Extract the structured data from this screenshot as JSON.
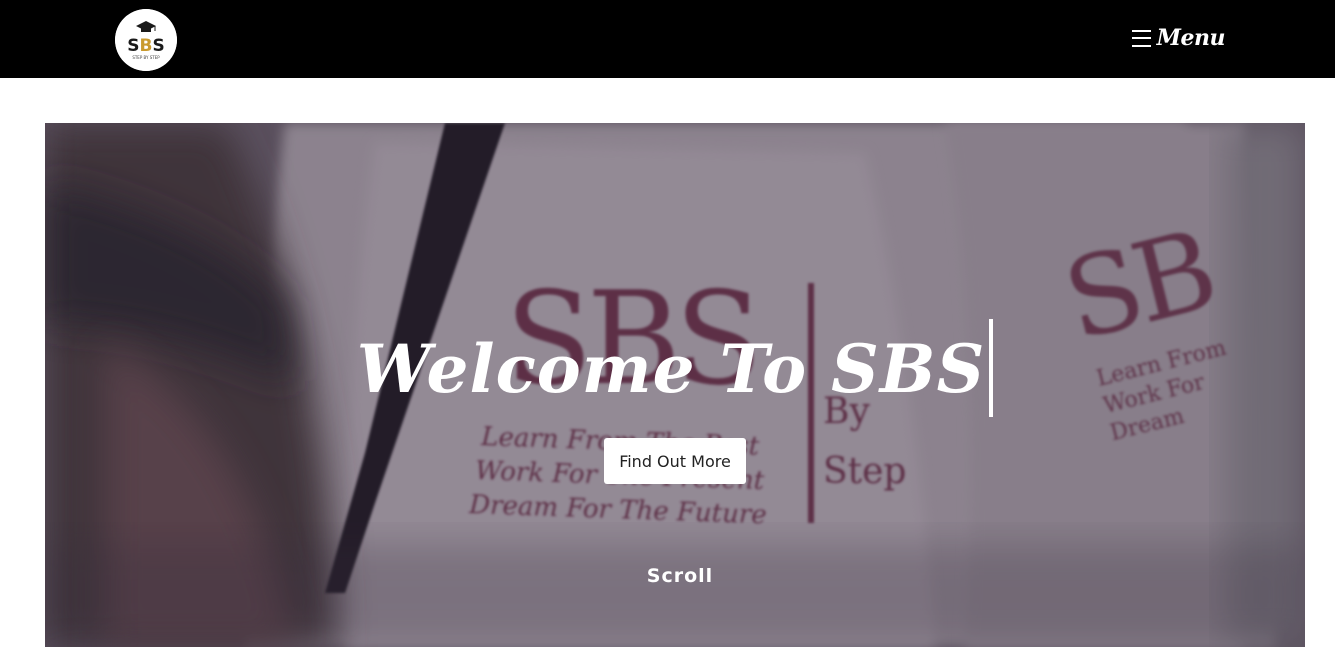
{
  "header": {
    "logo_text": "SBS",
    "logo_tagline": "STEP BY STEP",
    "menu_label": "Menu"
  },
  "hero": {
    "title": "Welcome To SBS",
    "cta_label": "Find Out More",
    "scroll_label": "Scroll",
    "photo_text": {
      "brand": "SBS",
      "line1": "Learn From The Past",
      "line2": "Work For The Present",
      "line3": "Dream For The Future",
      "side": "By Step"
    }
  },
  "colors": {
    "topbar": "#000000",
    "accent_maroon": "#7a1f3d",
    "text_light": "#ffffff"
  },
  "icons": [
    "hamburger-menu-icon"
  ]
}
